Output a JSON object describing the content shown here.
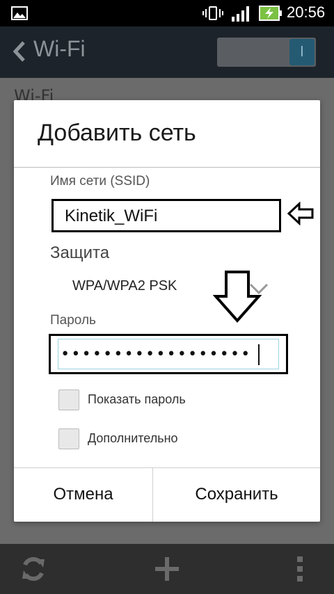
{
  "status_bar": {
    "time": "20:56",
    "icons": [
      "gallery-icon",
      "vibrate-icon",
      "signal-icon",
      "battery-charging-icon"
    ]
  },
  "action_bar": {
    "title": "Wi-Fi",
    "toggle_label": "I"
  },
  "background": {
    "wifi_label": "Wi-Fi"
  },
  "dialog": {
    "title": "Добавить сеть",
    "ssid_label": "Имя сети (SSID)",
    "ssid_value": "Kinetik_WiFi",
    "security_label": "Защита",
    "security_value": "WPA/WPA2 PSK",
    "password_label": "Пароль",
    "password_value": "••••••••••••••••••",
    "show_password_label": "Показать пароль",
    "advanced_label": "Дополнительно",
    "cancel_label": "Отмена",
    "save_label": "Сохранить"
  },
  "colors": {
    "accent_toggle": "#255a73",
    "password_focus": "#9ad3e0",
    "dim_overlay": "#6b6b6b"
  }
}
